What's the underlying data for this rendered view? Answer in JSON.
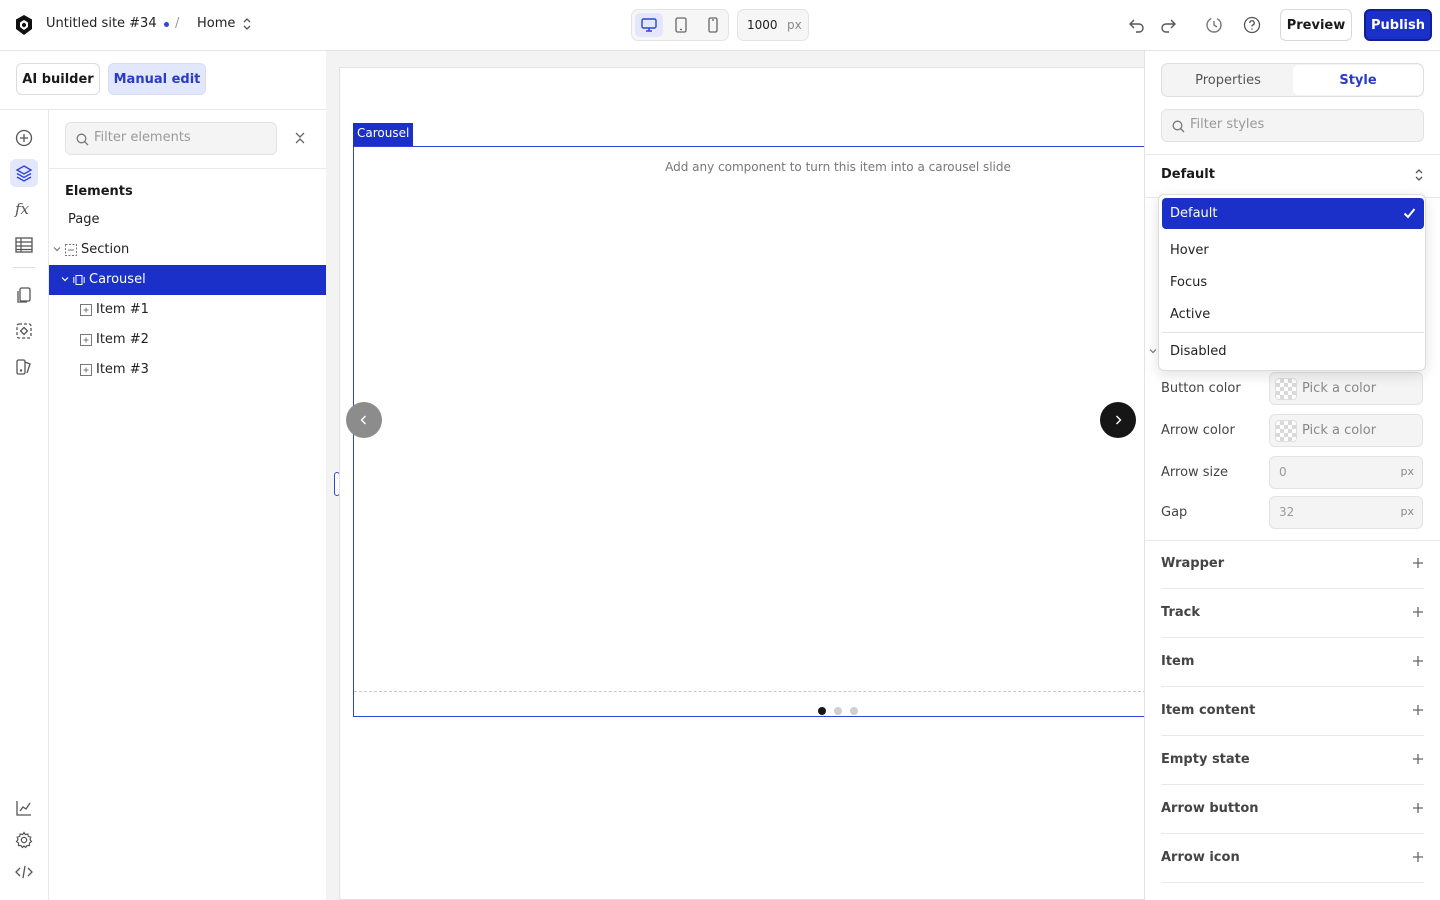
{
  "topbar": {
    "site_name": "Untitled site #34",
    "separator": "/",
    "page": "Home",
    "width_value": "1000",
    "width_unit": "px",
    "preview_label": "Preview",
    "publish_label": "Publish"
  },
  "modes": {
    "ai": "AI builder",
    "manual": "Manual edit"
  },
  "tree": {
    "filter_placeholder": "Filter elements",
    "title": "Elements",
    "items": [
      {
        "label": "Page",
        "icon": "none"
      },
      {
        "label": "Section",
        "icon": "section-icon"
      },
      {
        "label": "Carousel",
        "icon": "carousel-icon",
        "selected": true
      },
      {
        "label": "Item #1",
        "icon": "item-icon"
      },
      {
        "label": "Item #2",
        "icon": "item-icon"
      },
      {
        "label": "Item #3",
        "icon": "item-icon"
      }
    ]
  },
  "canvas": {
    "tag": "Carousel",
    "hint": "Add any component to turn this item into a carousel slide",
    "dots": 3,
    "active_dot": 0
  },
  "right": {
    "tabs": {
      "properties": "Properties",
      "style": "Style"
    },
    "filter_placeholder": "Filter styles",
    "state": "Default",
    "props": {
      "button_color": {
        "label": "Button color",
        "placeholder": "Pick a color"
      },
      "arrow_color": {
        "label": "Arrow color",
        "placeholder": "Pick a color"
      },
      "arrow_size": {
        "label": "Arrow size",
        "value": "0",
        "unit": "px"
      },
      "gap": {
        "label": "Gap",
        "value": "32",
        "unit": "px"
      }
    },
    "sections": [
      "Wrapper",
      "Track",
      "Item",
      "Item content",
      "Empty state",
      "Arrow button",
      "Arrow icon"
    ]
  },
  "dropdown": {
    "options": [
      "Default",
      "Hover",
      "Focus",
      "Active",
      "Disabled"
    ],
    "selected": "Default"
  },
  "colors": {
    "accent": "#1b2fc9",
    "accent_light": "#e3e7fb"
  }
}
